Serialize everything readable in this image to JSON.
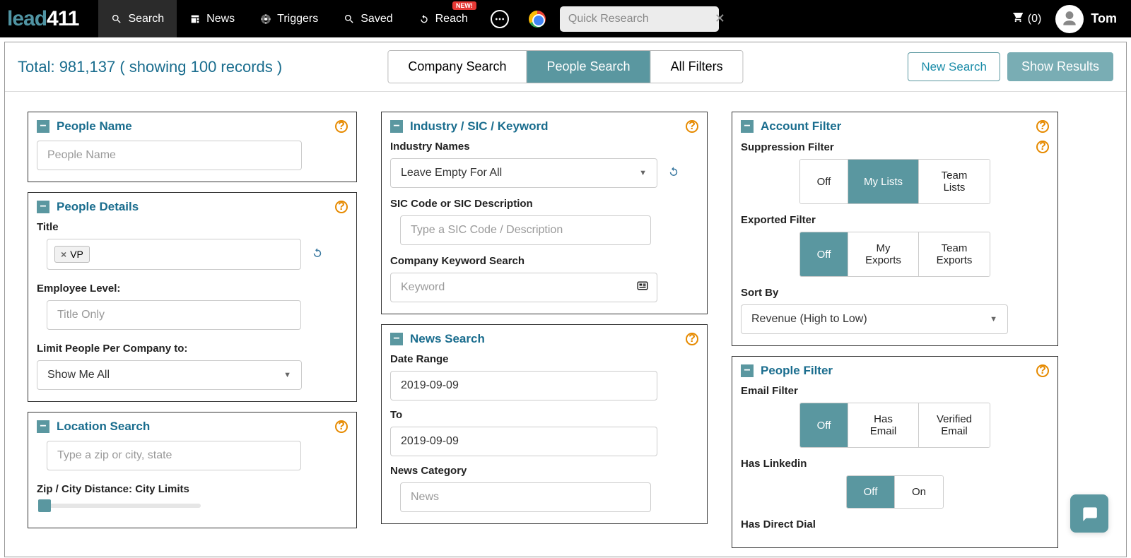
{
  "brand": {
    "part1": "lead",
    "part2": "411"
  },
  "nav": {
    "search": "Search",
    "news": "News",
    "triggers": "Triggers",
    "saved": "Saved",
    "reach": "Reach",
    "reach_badge": "NEW!",
    "quick_placeholder": "Quick Research",
    "cart": "(0)",
    "user": "Tom"
  },
  "summary": {
    "total_label": "Total: 981,137 ( showing 100 records )"
  },
  "tabs": {
    "company": "Company Search",
    "people": "People Search",
    "all": "All Filters"
  },
  "actions": {
    "new_search": "New Search",
    "show_results": "Show Results"
  },
  "people_name": {
    "title": "People Name",
    "placeholder": "People Name"
  },
  "people_details": {
    "title": "People Details",
    "title_label": "Title",
    "title_tag": "VP",
    "emp_level_label": "Employee Level:",
    "emp_level_placeholder": "Title Only",
    "limit_label": "Limit People Per Company to:",
    "limit_value": "Show Me All"
  },
  "location": {
    "title": "Location Search",
    "placeholder": "Type a zip or city, state",
    "distance_label": "Zip / City Distance: City Limits"
  },
  "industry": {
    "title": "Industry / SIC / Keyword",
    "names_label": "Industry Names",
    "names_value": "Leave Empty For All",
    "sic_label": "SIC Code or SIC Description",
    "sic_placeholder": "Type a SIC Code / Description",
    "keyword_label": "Company Keyword Search",
    "keyword_placeholder": "Keyword"
  },
  "news": {
    "title": "News Search",
    "date_range_label": "Date Range",
    "date_from": "2019-09-09",
    "to_label": "To",
    "date_to": "2019-09-09",
    "category_label": "News Category",
    "category_placeholder": "News"
  },
  "account_filter": {
    "title": "Account Filter",
    "suppression_label": "Suppression Filter",
    "supp_off": "Off",
    "supp_my": "My Lists",
    "supp_team": "Team Lists",
    "exported_label": "Exported Filter",
    "exp_off": "Off",
    "exp_my": "My Exports",
    "exp_team": "Team Exports",
    "sort_label": "Sort By",
    "sort_value": "Revenue (High to Low)"
  },
  "people_filter": {
    "title": "People Filter",
    "email_label": "Email Filter",
    "email_off": "Off",
    "email_has": "Has Email",
    "email_verified": "Verified Email",
    "linkedin_label": "Has Linkedin",
    "li_off": "Off",
    "li_on": "On",
    "dial_label": "Has Direct Dial"
  }
}
